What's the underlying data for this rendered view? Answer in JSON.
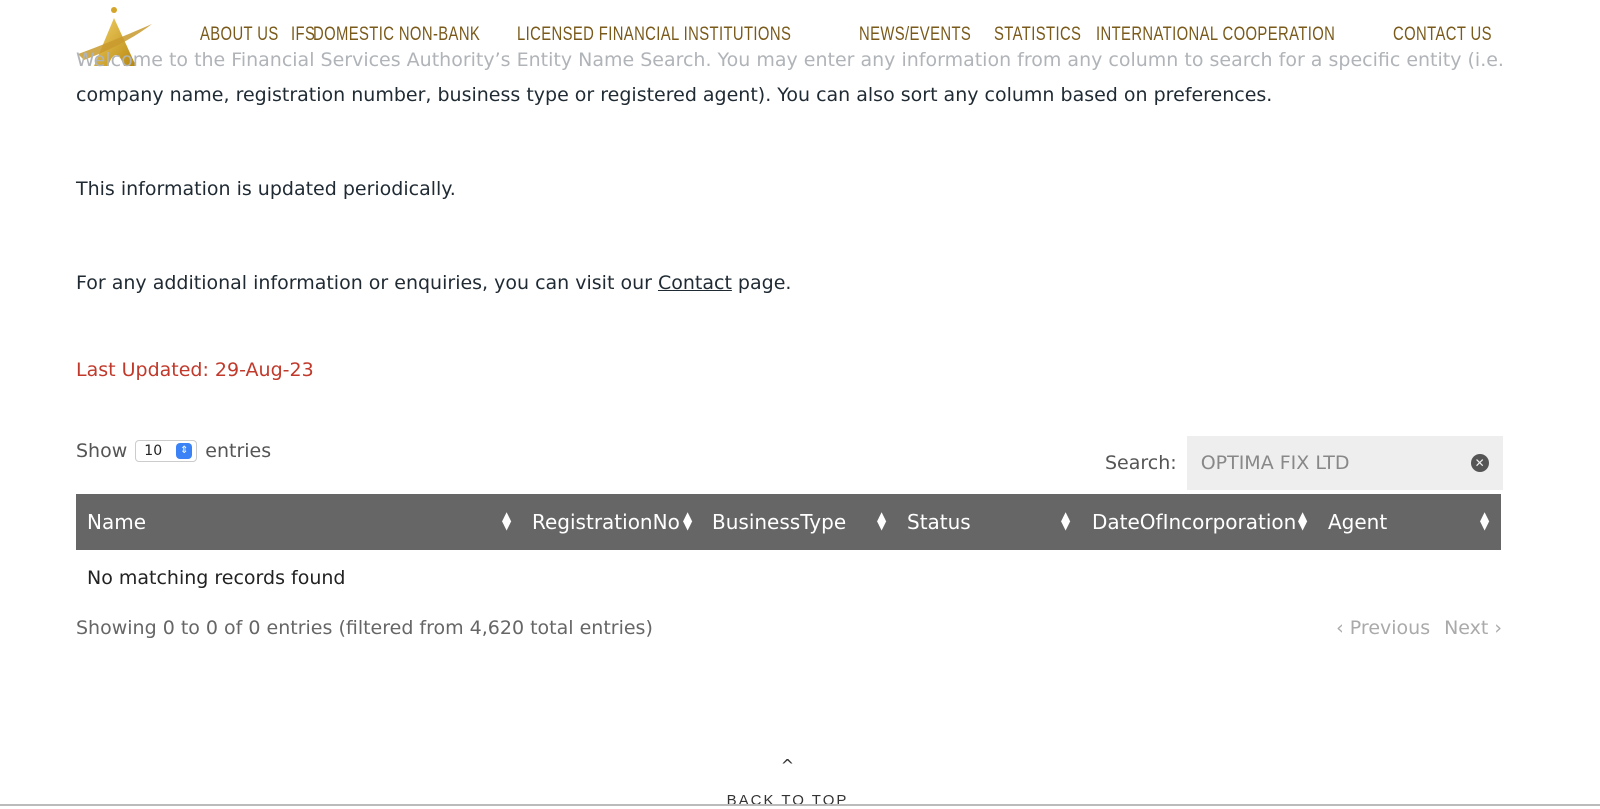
{
  "nav": {
    "items": [
      "ABOUT US",
      "IFS",
      "DOMESTIC NON-BANK",
      "LICENSED FINANCIAL INSTITUTIONS",
      "NEWS/EVENTS",
      "STATISTICS",
      "INTERNATIONAL COOPERATION",
      "CONTACT US"
    ]
  },
  "intro": {
    "line1": "Welcome to the Financial Services Authority’s Entity Name Search. You may enter any information from any column to search for a specific entity (i.e.",
    "line2": "company name, registration number, business type or registered agent). You can also sort any column based on preferences.",
    "updated": "This information is updated periodically.",
    "contact_prefix": "For any additional information or enquiries, you can visit our ",
    "contact_link": "Contact",
    "contact_suffix": " page."
  },
  "last_updated": "Last Updated:  29-Aug-23",
  "table_controls": {
    "show_label": "Show",
    "entries_value": "10",
    "entries_label": "entries",
    "search_label": "Search:",
    "search_value": "OPTIMA FIX LTD"
  },
  "table": {
    "columns": [
      "Name",
      "RegistrationNo",
      "BusinessType",
      "Status",
      "DateOfIncorporation",
      "Agent"
    ],
    "empty_message": "No matching records found"
  },
  "footer_info": "Showing 0 to 0 of 0 entries (filtered from 4,620 total entries)",
  "pager": {
    "previous": "Previous",
    "next": "Next"
  },
  "back_to_top": "BACK TO TOP",
  "colors": {
    "nav": "#7a5a1a",
    "header_bg": "#666666",
    "last_updated": "#c0392b",
    "logo_gold": "#d4a52a"
  }
}
